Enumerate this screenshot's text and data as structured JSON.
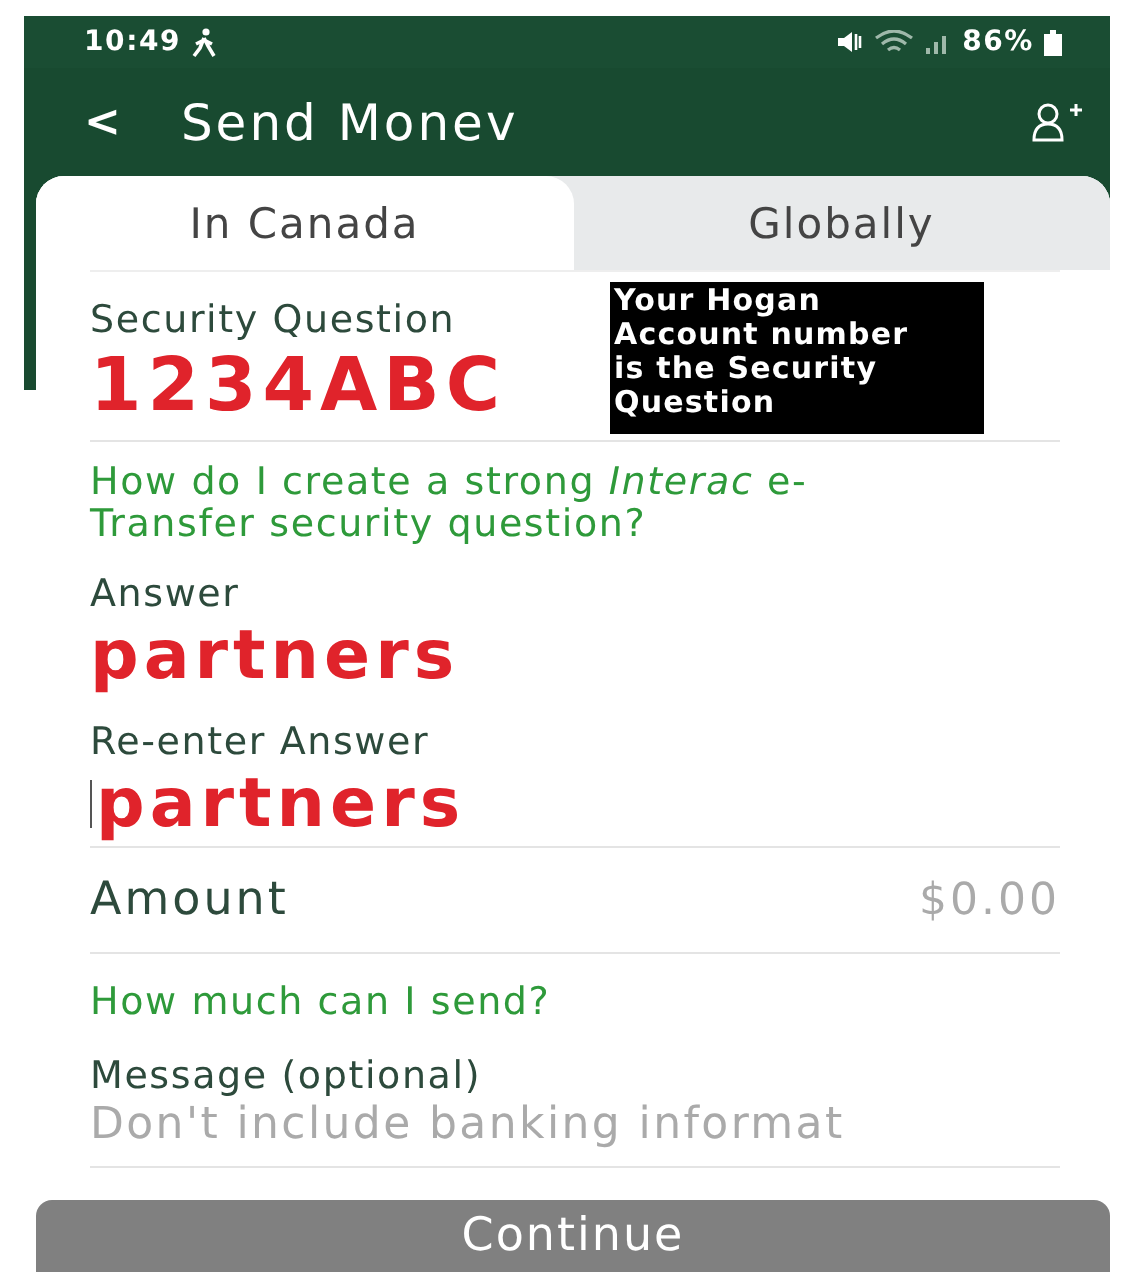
{
  "status_bar": {
    "time": "10:49",
    "battery": "86%"
  },
  "header": {
    "back": "<",
    "title": "Send Monev"
  },
  "tabs": [
    {
      "label": "In Canada",
      "selected": true
    },
    {
      "label": "Globally",
      "selected": false
    }
  ],
  "security_question": {
    "label": "Security Question",
    "value": "1234ABC"
  },
  "annotation": "Your Hogan Account number is the Security Question",
  "help_link": "How do I create a strong *Interac* e-Transfer security question?",
  "answer": {
    "label": "Answer",
    "value": "partners"
  },
  "reenter_answer": {
    "label": "Re-enter Answer",
    "value": "partners",
    "focused": true
  },
  "amount": {
    "label": "Amount",
    "value": "$0.00"
  },
  "limit_link": "How much can I send?",
  "message": {
    "label": "Message (optional)",
    "placeholder": "Don't include banking informat"
  },
  "continue_button": "Continue"
}
